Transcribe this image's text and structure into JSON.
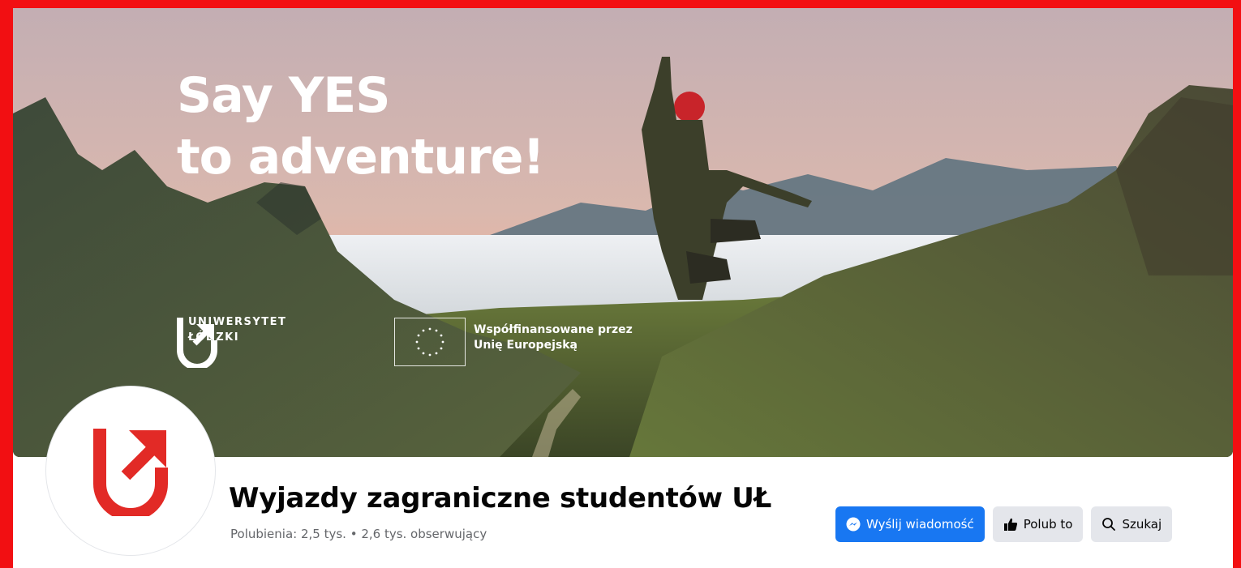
{
  "cover": {
    "headline_line1": "Say YES",
    "headline_line2": "to adventure!",
    "university_line1": "UNIWERSYTET",
    "university_line2": "ŁÓDZKI",
    "eu_line1": "Współfinansowane przez",
    "eu_line2": "Unię Europejską"
  },
  "page": {
    "name": "Wyjazdy zagraniczne studentów UŁ",
    "stats": "Polubienia: 2,5 tys. • 2,6 tys. obserwujący"
  },
  "actions": {
    "message_label": "Wyślij wiadomość",
    "like_label": "Polub to",
    "search_label": "Szukaj"
  },
  "icons": {
    "message": "messenger-icon",
    "like": "thumbs-up-icon",
    "search": "search-icon",
    "logo": "uniwersytet-lodzki-logo"
  },
  "colors": {
    "frame": "#f20f12",
    "brand_red": "#e22a26",
    "primary": "#1877f2",
    "secondary": "#e4e6eb"
  }
}
